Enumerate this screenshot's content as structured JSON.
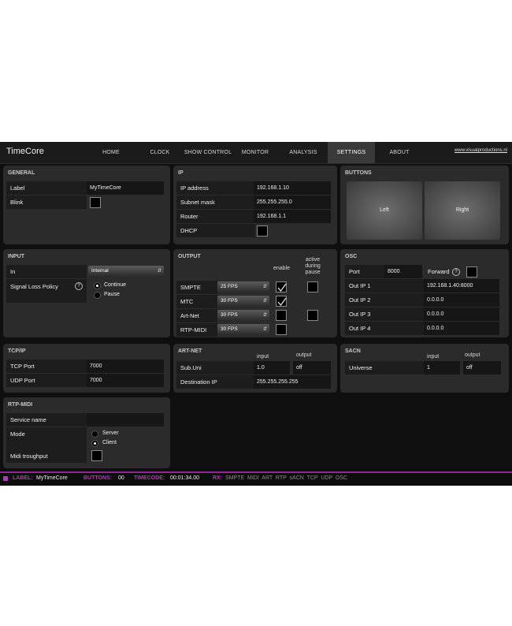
{
  "app": {
    "title": "TimeCore",
    "site_link": "www.visualproductions.nl"
  },
  "nav": {
    "tabs": [
      "HOME",
      "CLOCK",
      "SHOW CONTROL",
      "MONITOR",
      "ANALYSIS",
      "SETTINGS",
      "ABOUT"
    ],
    "active": "SETTINGS"
  },
  "general": {
    "title": "GENERAL",
    "label_label": "Label",
    "label_value": "MyTimeCore",
    "blink_label": "Blink",
    "blink_checked": false
  },
  "ip": {
    "title": "IP",
    "address_label": "IP address",
    "address_value": "192.168.1.10",
    "subnet_label": "Subnet mask",
    "subnet_value": "255.255.255.0",
    "router_label": "Router",
    "router_value": "192.168.1.1",
    "dhcp_label": "DHCP",
    "dhcp_checked": false
  },
  "buttons": {
    "title": "BUTTONS",
    "left": "Left",
    "right": "Right"
  },
  "input": {
    "title": "INPUT",
    "in_label": "In",
    "in_value": "Internal",
    "policy_label": "Signal Loss Policy",
    "help": "?",
    "opt_continue": "Continue",
    "opt_pause": "Pause",
    "selected": "Continue"
  },
  "output": {
    "title": "OUTPUT",
    "col_enable": "enable",
    "col_active": "active during pause",
    "rows": [
      {
        "label": "SMPTE",
        "fps": "25 FPS",
        "enable": true,
        "active": false
      },
      {
        "label": "MTC",
        "fps": "30 FPS",
        "enable": true,
        "active": null
      },
      {
        "label": "Art-Net",
        "fps": "30 FPS",
        "enable": false,
        "active": false
      },
      {
        "label": "RTP-MIDI",
        "fps": "30 FPS",
        "enable": false,
        "active": null
      }
    ]
  },
  "osc": {
    "title": "OSC",
    "port_label": "Port",
    "port_value": "8000",
    "forward_label": "Forward",
    "help": "?",
    "forward_checked": false,
    "outs": [
      {
        "label": "Out IP 1",
        "value": "192.168.1.40:8000"
      },
      {
        "label": "Out IP 2",
        "value": "0.0.0.0"
      },
      {
        "label": "Out IP 3",
        "value": "0.0.0.0"
      },
      {
        "label": "Out IP 4",
        "value": "0.0.0.0"
      }
    ]
  },
  "tcpip": {
    "title": "TCP/IP",
    "tcp_label": "TCP Port",
    "tcp_value": "7000",
    "udp_label": "UDP Port",
    "udp_value": "7000"
  },
  "artnet": {
    "title": "ART-NET",
    "col_input": "input",
    "col_output": "output",
    "subuni_label": "Sub.Uni",
    "subuni_input": "1.0",
    "subuni_output": "off",
    "dest_label": "Destination IP",
    "dest_value": "255.255.255.255"
  },
  "sacn": {
    "title": "SACN",
    "col_input": "input",
    "col_output": "output",
    "universe_label": "Universe",
    "universe_input": "1",
    "universe_output": "off"
  },
  "rtpmidi": {
    "title": "RTP-MIDI",
    "service_label": "Service name",
    "service_value": "",
    "mode_label": "Mode",
    "opt_server": "Server",
    "opt_client": "Client",
    "selected": "Client",
    "midi_label": "Midi troughput",
    "midi_checked": false
  },
  "status": {
    "label_key": "LABEL:",
    "label_val": "MyTimeCore",
    "buttons_key": "BUTTONS:",
    "buttons_val": "00",
    "timecode_key": "TIMECODE:",
    "timecode_val": "00:01:34.00",
    "rx_key": "RX:",
    "rx_items": "SMPTE  MIDI  ART  RTP  sACN  TCP  UDP  OSC"
  },
  "colors": {
    "accent": "#b03ab0",
    "background": "#0f0f0f",
    "panel": "#2b2b2b"
  }
}
